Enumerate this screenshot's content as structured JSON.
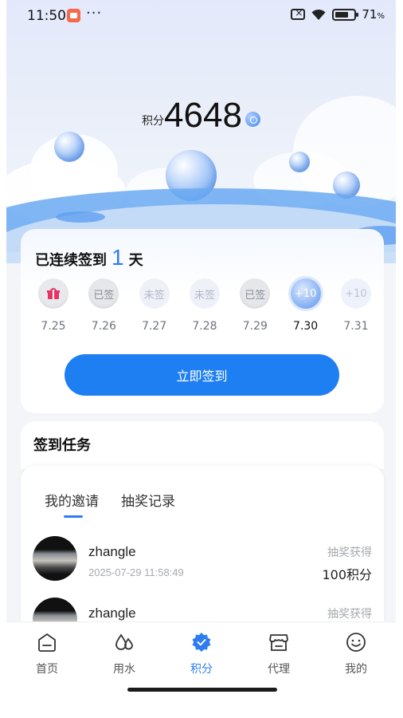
{
  "status_bar": {
    "time": "11:50",
    "dots": "···",
    "battery": "71",
    "battery_unit": "%"
  },
  "points": {
    "label": "积分",
    "value": "4648"
  },
  "sign_card": {
    "streak_prefix": "已连续签到",
    "streak_days": "1",
    "streak_suffix": "天",
    "days": [
      {
        "state": "gift",
        "label": "",
        "date": "7.25"
      },
      {
        "state": "done",
        "label": "已签",
        "date": "7.26"
      },
      {
        "state": "missed",
        "label": "未签",
        "date": "7.27"
      },
      {
        "state": "missed",
        "label": "未签",
        "date": "7.28"
      },
      {
        "state": "done",
        "label": "已签",
        "date": "7.29"
      },
      {
        "state": "today",
        "label": "+10",
        "date": "7.30"
      },
      {
        "state": "future",
        "label": "+10",
        "date": "7.31"
      }
    ],
    "button_label": "立即签到"
  },
  "tasks": {
    "title": "签到任务"
  },
  "records": {
    "tabs": [
      {
        "label": "我的邀请",
        "active": true
      },
      {
        "label": "抽奖记录",
        "active": false
      }
    ],
    "items": [
      {
        "name": "zhangle",
        "time": "2025-07-29 11:58:49",
        "label": "抽奖获得",
        "amount": "100积分"
      },
      {
        "name": "zhangle",
        "time": "",
        "label": "抽奖获得",
        "amount": ""
      }
    ]
  },
  "bottom_nav": [
    {
      "label": "首页",
      "icon": "home-icon",
      "active": false
    },
    {
      "label": "用水",
      "icon": "water-icon",
      "active": false
    },
    {
      "label": "积分",
      "icon": "points-badge-icon",
      "active": true
    },
    {
      "label": "代理",
      "icon": "store-icon",
      "active": false
    },
    {
      "label": "我的",
      "icon": "smiley-icon",
      "active": false
    }
  ],
  "colors": {
    "accent": "#1e7ff3",
    "gift": "#e83464"
  }
}
